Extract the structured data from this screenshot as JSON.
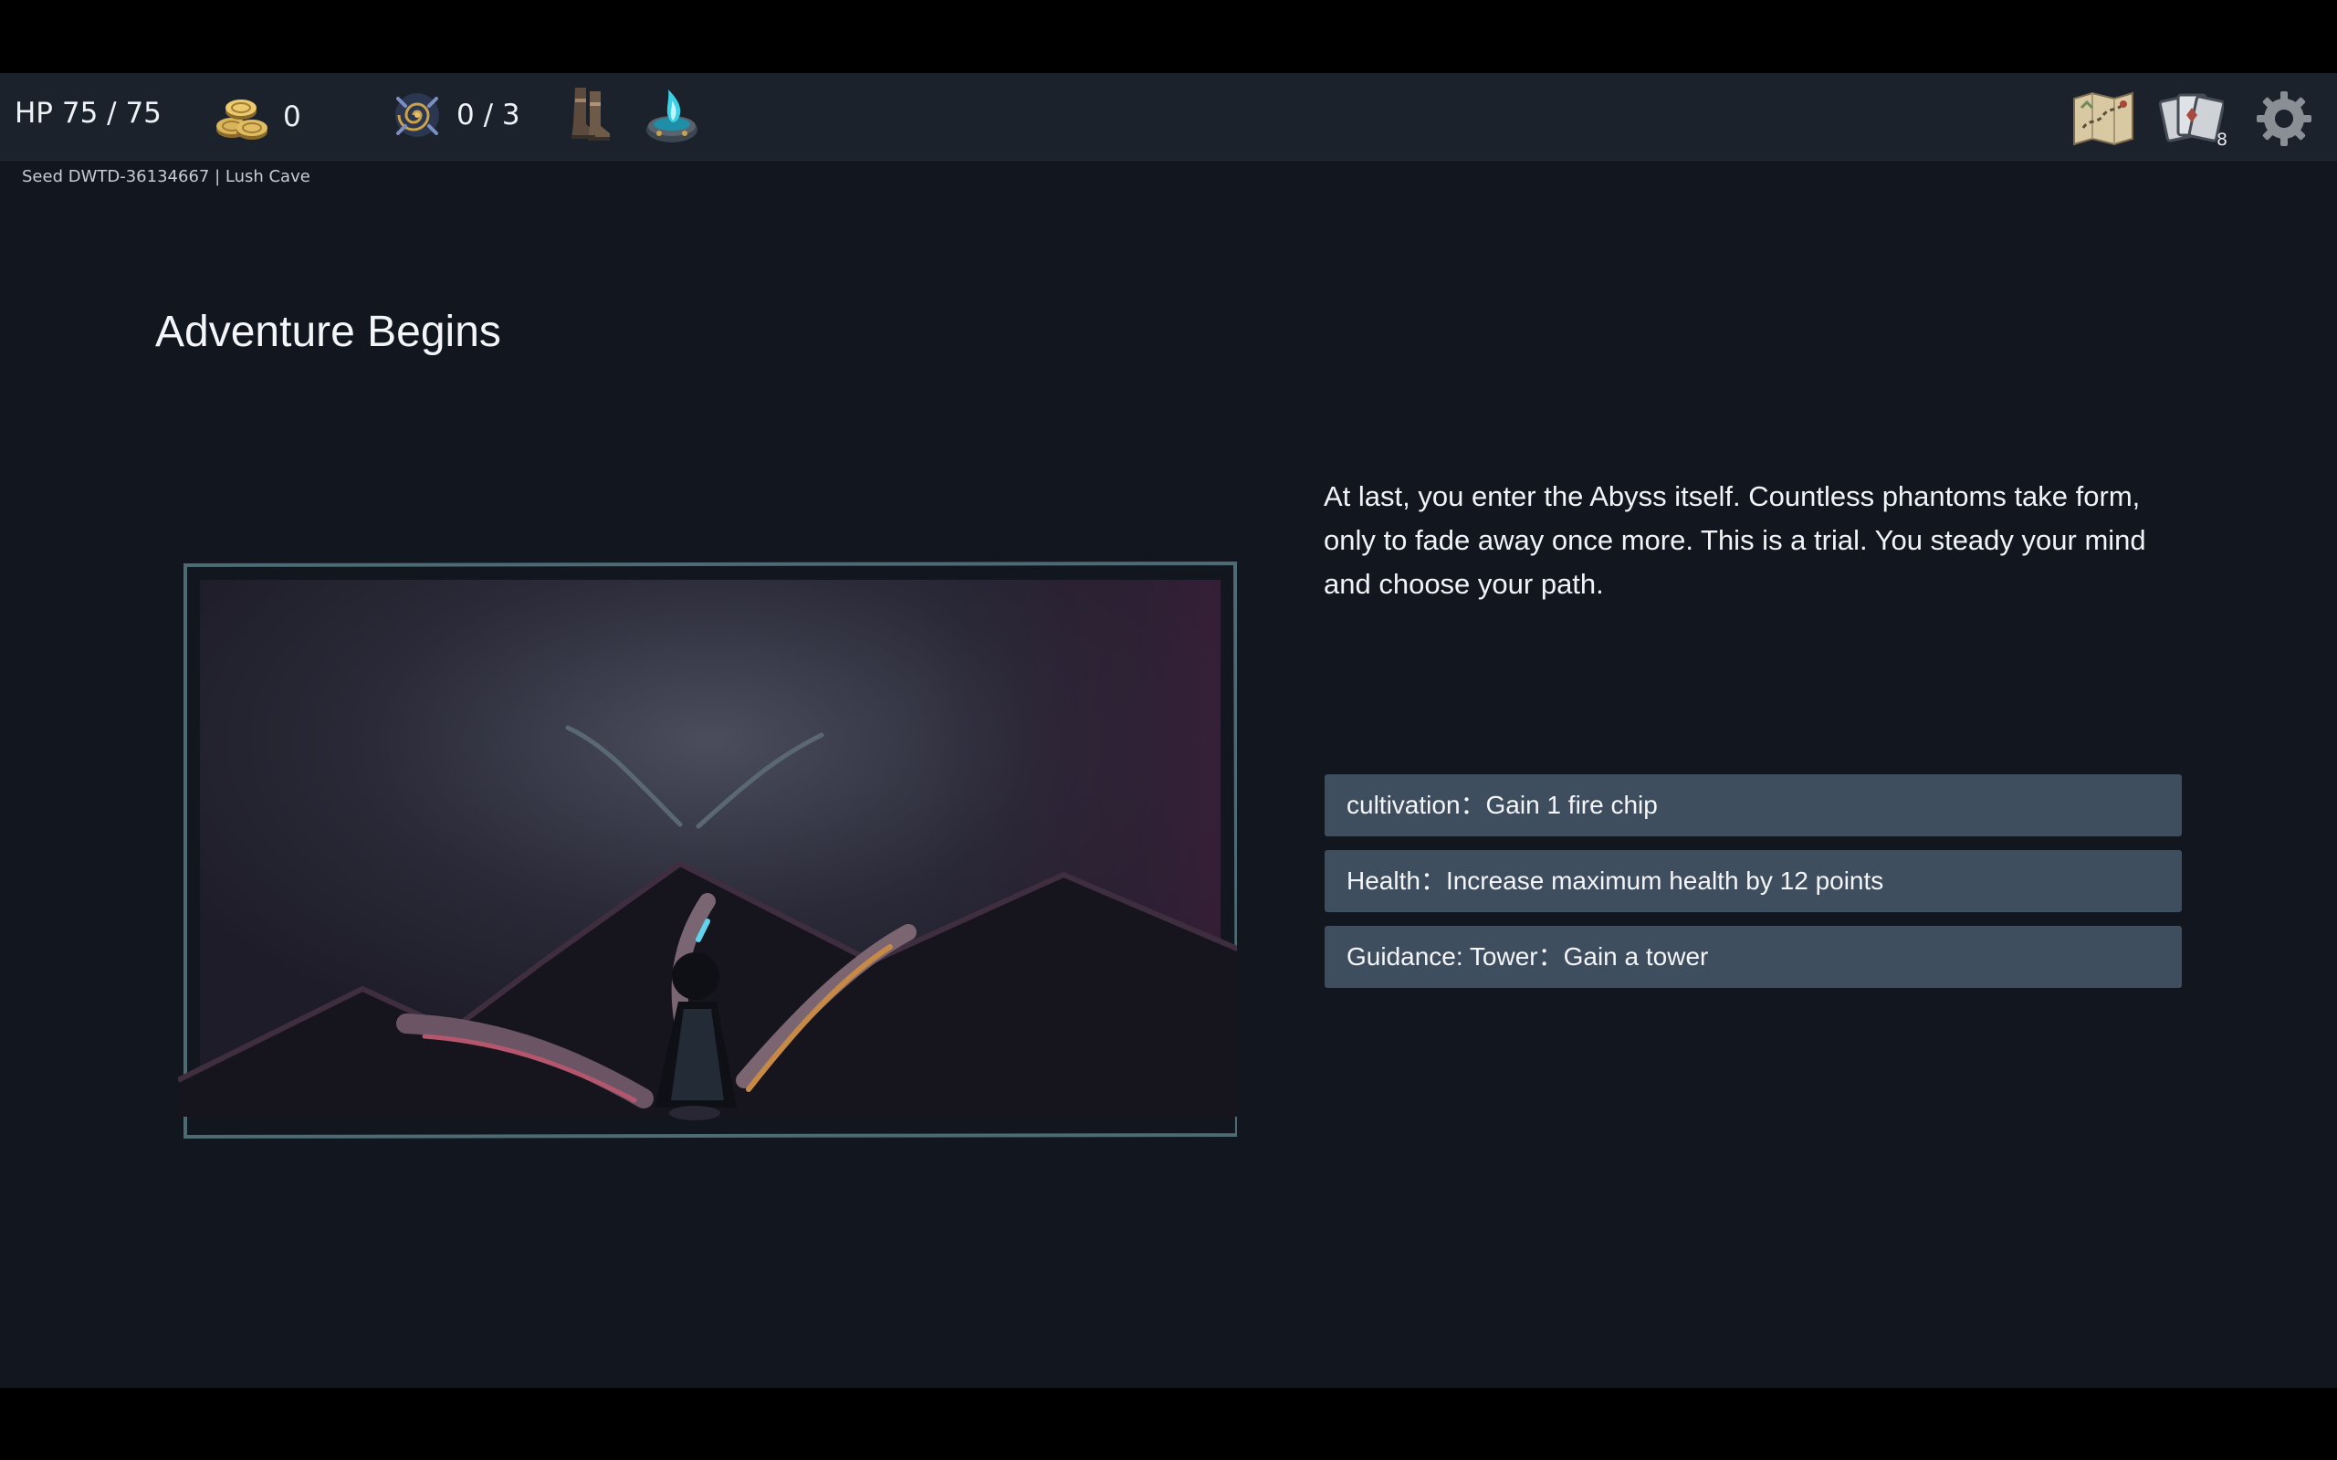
{
  "hud": {
    "hp_text": "HP 75 / 75",
    "gold": "0",
    "charges": "0 / 3",
    "deck_count": "8"
  },
  "seed_text": "Seed DWTD-36134667 | Lush Cave",
  "event": {
    "title": "Adventure Begins",
    "description": "At last, you enter the Abyss itself. Countless phantoms take form, only to fade away once more. This is a trial. You steady your mind and choose your path.",
    "choices": [
      {
        "label": "cultivation：Gain 1 fire chip"
      },
      {
        "label": "Health：Increase maximum health by 12 points"
      },
      {
        "label": "Guidance: Tower：Gain a tower"
      }
    ]
  },
  "icons": {
    "gold": "gold-coins-icon",
    "charges": "spiral-rune-icon",
    "relic_1": "boots-icon",
    "relic_2": "blue-flame-brazier-icon",
    "map": "map-icon",
    "deck": "card-deck-icon",
    "settings": "gear-icon"
  },
  "colors": {
    "background": "#12171f",
    "topbar": "#1b222c",
    "choice_bg": "#3f4e5e",
    "frame": "#4b6a72"
  }
}
